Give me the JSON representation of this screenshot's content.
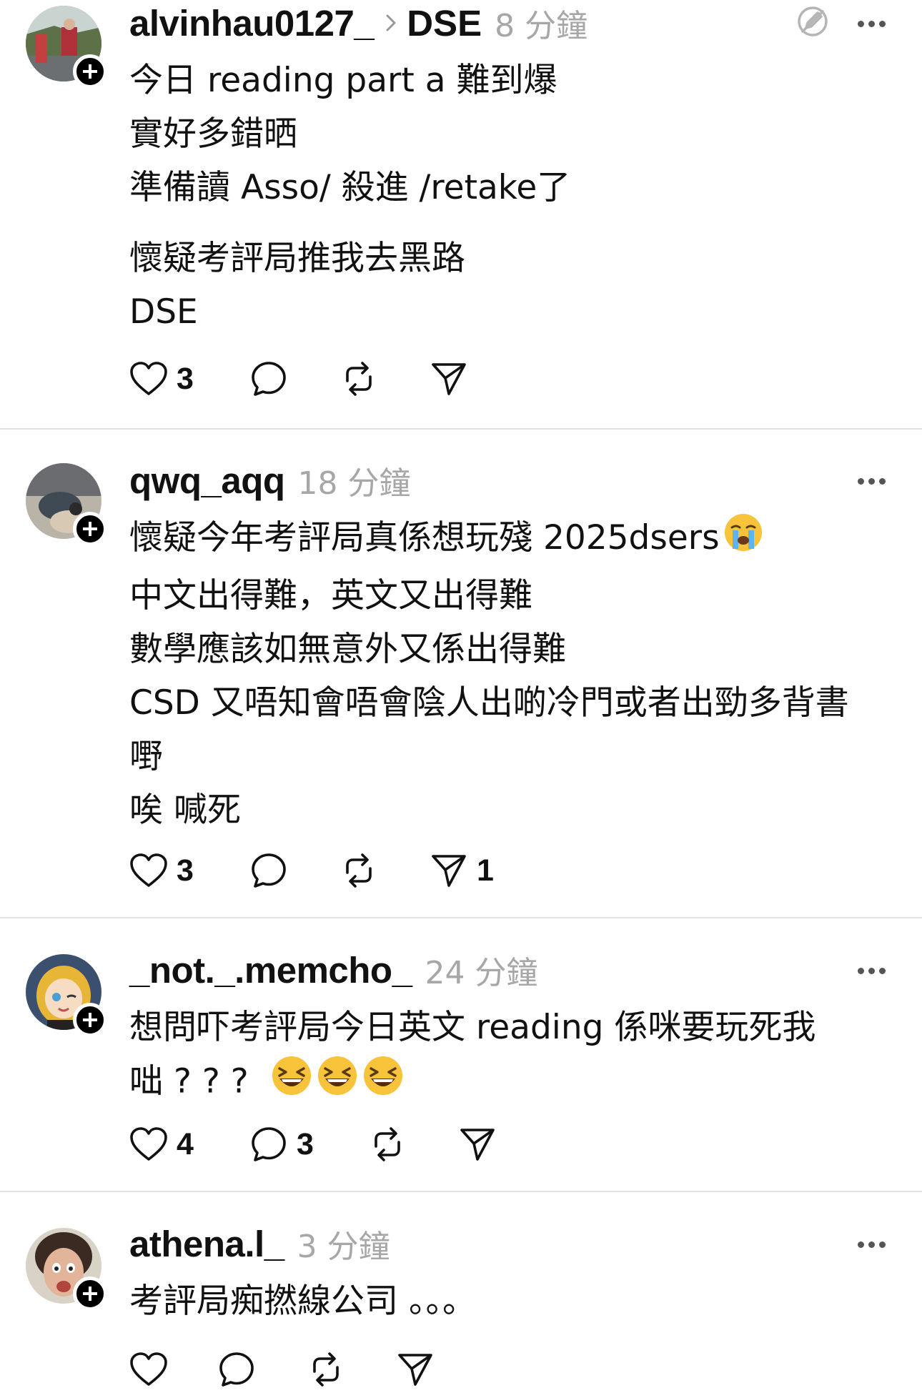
{
  "posts": [
    {
      "username": "alvinhau0127_",
      "topic": "DSE",
      "time": "8 分鐘",
      "lines": [
        "今日 reading part a 難到爆",
        "實好多錯晒",
        "準備讀 Asso/ 殺進 /retake了",
        "",
        "懷疑考評局推我去黑路",
        "DSE"
      ],
      "likes": "3",
      "replies": "",
      "reposts": "",
      "shares": ""
    },
    {
      "username": "qwq_aqq",
      "time": "18 分鐘",
      "lines": [
        "懷疑今年考評局真係想玩殘 2025dsers",
        "中文出得難，英文又出得難",
        "數學應該如無意外又係出得難",
        "CSD 又唔知會唔會陰人出啲冷門或者出勁多背書",
        "嘢",
        "唉 喊死"
      ],
      "emoji_after_line_1": "loudly-crying-face-emoji",
      "likes": "3",
      "replies": "",
      "reposts": "",
      "shares": "1"
    },
    {
      "username": "_not._.memcho_",
      "time": "24 分鐘",
      "lines": [
        "想問吓考評局今日英文 reading 係咪要玩死我",
        "咄 ? ? ?"
      ],
      "trailing_emoji": [
        "grinning-squinting-face-emoji",
        "grinning-squinting-face-emoji",
        "grinning-squinting-face-emoji"
      ],
      "likes": "4",
      "replies": "3",
      "reposts": "",
      "shares": ""
    },
    {
      "username": "athena.l_",
      "time": "3 分鐘",
      "lines": [
        "考評局痴撚線公司 。。。"
      ],
      "likes": "",
      "replies": "",
      "reposts": "",
      "shares": ""
    }
  ]
}
